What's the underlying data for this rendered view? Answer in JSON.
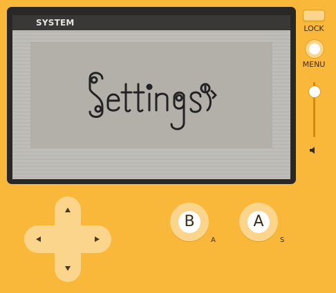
{
  "screen": {
    "title": "SYSTEM",
    "wordmark": "Settings"
  },
  "controls": {
    "lock_label": "LOCK",
    "menu_label": "MENU",
    "b_button": "B",
    "a_button": "A",
    "b_key_hint": "A",
    "a_key_hint": "S",
    "volume_level": 0.82
  },
  "colors": {
    "body": "#f9b83a",
    "bezel": "#2a2826",
    "button_face": "#fbd58c",
    "screen_ink": "#222222"
  },
  "icons": {
    "volume": "speaker-icon",
    "dpad_up": "arrow-up-icon",
    "dpad_down": "arrow-down-icon",
    "dpad_left": "arrow-left-icon",
    "dpad_right": "arrow-right-icon"
  }
}
